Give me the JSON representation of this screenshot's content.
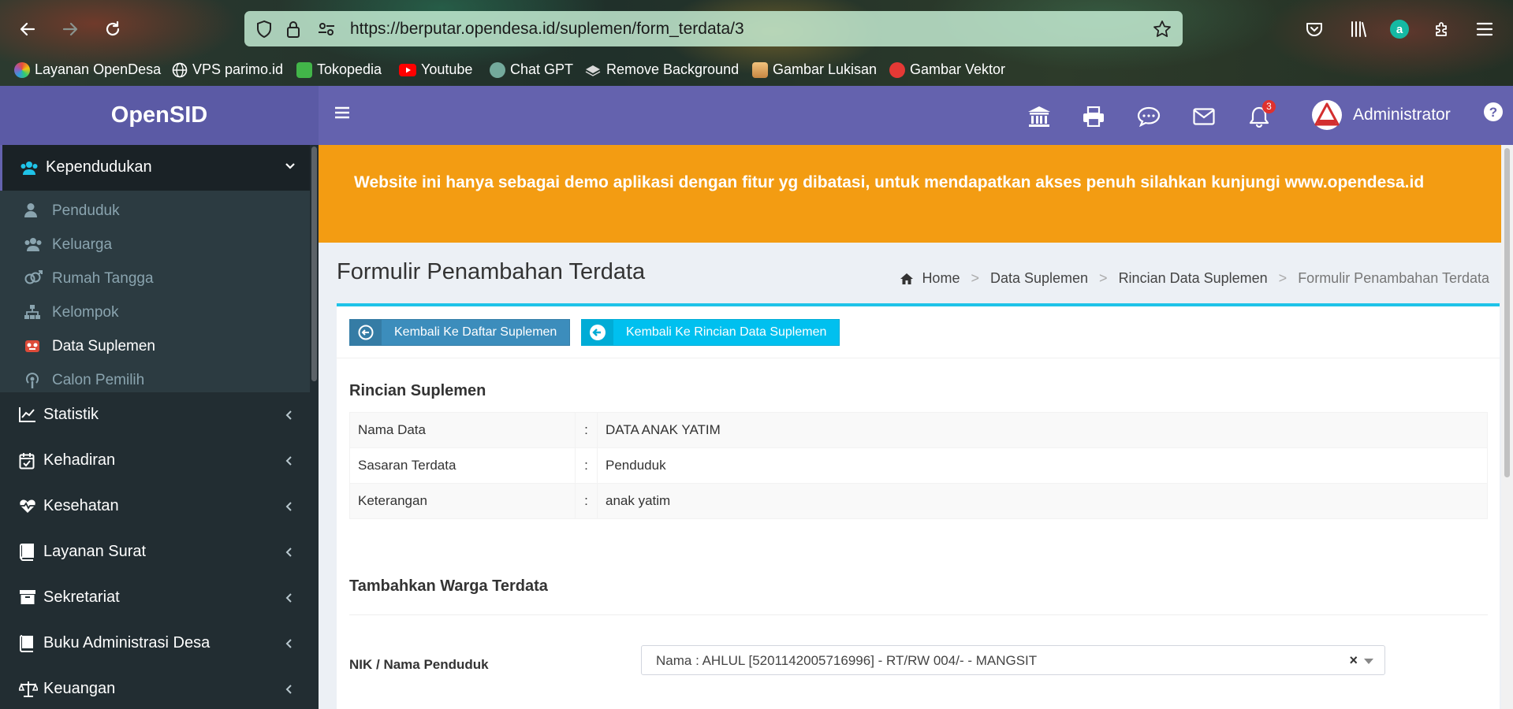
{
  "browser": {
    "url": "https://berputar.opendesa.id/suplemen/form_terdata/3",
    "bookmarks": [
      {
        "label": "Layanan OpenDesa"
      },
      {
        "label": "VPS parimo.id"
      },
      {
        "label": "Tokopedia"
      },
      {
        "label": "Youtube"
      },
      {
        "label": "Chat GPT"
      },
      {
        "label": "Remove Background"
      },
      {
        "label": "Gambar Lukisan"
      },
      {
        "label": "Gambar Vektor"
      }
    ]
  },
  "app": {
    "logo": "OpenSID",
    "notification_count": "3",
    "user_name": "Administrator"
  },
  "sidebar": {
    "active_group": "Kependudukan",
    "subitems": [
      {
        "label": "Penduduk",
        "icon": "user-icon"
      },
      {
        "label": "Keluarga",
        "icon": "users-icon"
      },
      {
        "label": "Rumah Tangga",
        "icon": "venus-mars-icon"
      },
      {
        "label": "Kelompok",
        "icon": "sitemap-icon"
      },
      {
        "label": "Data Suplemen",
        "icon": "suplemen-icon",
        "active": true
      },
      {
        "label": "Calon Pemilih",
        "icon": "podcast-icon"
      }
    ],
    "items": [
      {
        "label": "Statistik",
        "icon": "line-chart-icon"
      },
      {
        "label": "Kehadiran",
        "icon": "calendar-check-icon"
      },
      {
        "label": "Kesehatan",
        "icon": "heartbeat-icon"
      },
      {
        "label": "Layanan Surat",
        "icon": "book-icon"
      },
      {
        "label": "Sekretariat",
        "icon": "archive-icon"
      },
      {
        "label": "Buku Administrasi Desa",
        "icon": "book-icon"
      },
      {
        "label": "Keuangan",
        "icon": "balance-scale-icon"
      }
    ]
  },
  "alert": "Website ini hanya sebagai demo aplikasi dengan fitur yg dibatasi, untuk mendapatkan akses penuh silahkan kunjungi www.opendesa.id",
  "page": {
    "title": "Formulir Penambahan Terdata",
    "breadcrumb": [
      "Home",
      "Data Suplemen",
      "Rincian Data Suplemen",
      "Formulir Penambahan Terdata"
    ]
  },
  "buttons": {
    "back_list": "Kembali Ke Daftar Suplemen",
    "back_detail": "Kembali Ke Rincian Data Suplemen"
  },
  "rincian": {
    "title": "Rincian Suplemen",
    "rows": [
      {
        "label": "Nama Data",
        "sep": ":",
        "value": "DATA ANAK YATIM"
      },
      {
        "label": "Sasaran Terdata",
        "sep": ":",
        "value": "Penduduk"
      },
      {
        "label": "Keterangan",
        "sep": ":",
        "value": "anak yatim"
      }
    ]
  },
  "form": {
    "title": "Tambahkan Warga Terdata",
    "nik_label": "NIK / Nama Penduduk",
    "nik_value": "Nama : AHLUL [5201142005716996] - RT/RW 004/- - MANGSIT",
    "clear_symbol": "×"
  }
}
